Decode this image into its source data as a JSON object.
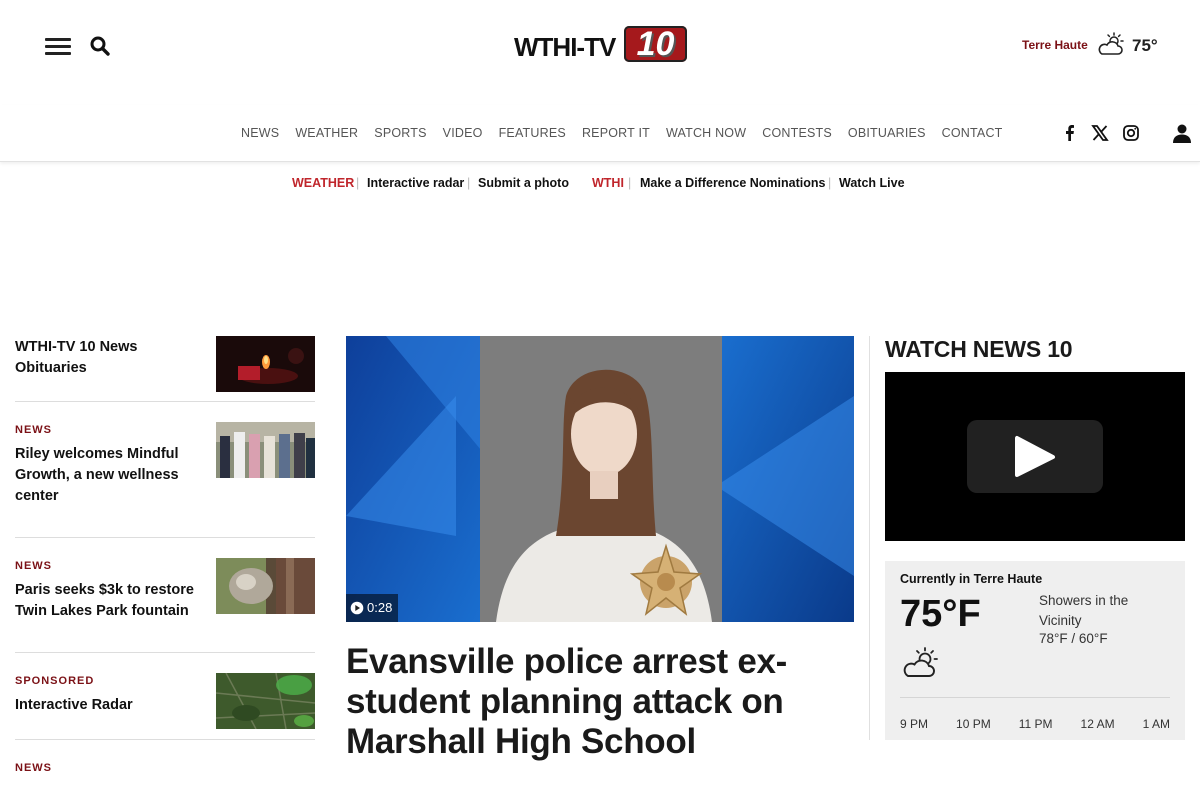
{
  "header": {
    "logo_text": "WTHI-TV",
    "logo_number": "10",
    "weather_city": "Terre Haute",
    "weather_temp": "75°"
  },
  "nav": {
    "items": [
      "NEWS",
      "WEATHER",
      "SPORTS",
      "VIDEO",
      "FEATURES",
      "REPORT IT",
      "WATCH NOW",
      "CONTESTS",
      "OBITUARIES",
      "CONTACT"
    ]
  },
  "subbar": {
    "weather_tag": "WEATHER",
    "radar": "Interactive radar",
    "photo": "Submit a photo",
    "wthi_tag": "WTHI",
    "nominations": "Make a Difference Nominations",
    "watch_live": "Watch Live"
  },
  "stories": [
    {
      "kicker": "",
      "title": "WTHI-TV 10 News Obituaries"
    },
    {
      "kicker": "NEWS",
      "title": "Riley welcomes Mindful Growth, a new wellness center"
    },
    {
      "kicker": "NEWS",
      "title": "Paris seeks $3k to restore Twin Lakes Park fountain"
    },
    {
      "kicker": "SPONSORED",
      "title": "Interactive Radar"
    },
    {
      "kicker": "NEWS",
      "title": ""
    }
  ],
  "hero": {
    "duration": "0:28",
    "headline": "Evansville police arrest ex-student planning attack on Marshall High School"
  },
  "watch": {
    "title": "WATCH NEWS 10"
  },
  "weather_box": {
    "label": "Currently in Terre Haute",
    "temp": "75°F",
    "condition": "Showers in the Vicinity",
    "hi_lo": "78°F / 60°F",
    "hours": [
      "9 PM",
      "10 PM",
      "11 PM",
      "12 AM",
      "1 AM"
    ]
  },
  "colors": {
    "accent": "#7b1116",
    "red": "#c0262c"
  }
}
